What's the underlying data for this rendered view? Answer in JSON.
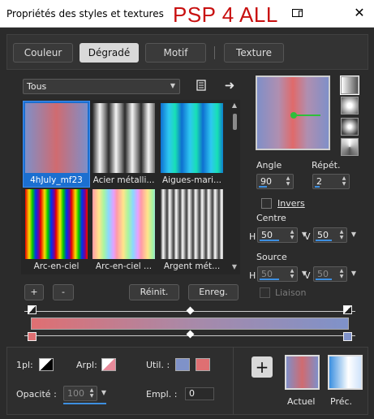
{
  "window": {
    "title": "Propriétés des styles et textures",
    "watermark": "PSP 4 ALL",
    "close_glyph": "✕"
  },
  "tabs": [
    {
      "label": "Couleur",
      "active": false
    },
    {
      "label": "Dégradé",
      "active": true
    },
    {
      "label": "Motif",
      "active": false
    },
    {
      "label": "Texture",
      "active": false
    }
  ],
  "library": {
    "category": "Tous",
    "swatches": [
      {
        "caption": "4hJuly_mf23",
        "selected": true
      },
      {
        "caption": "Acier métalli...",
        "selected": false
      },
      {
        "caption": "Aigues-mari...",
        "selected": false
      },
      {
        "caption": "Arc-en-ciel",
        "selected": false
      },
      {
        "caption": "Arc-en-ciel ...",
        "selected": false
      },
      {
        "caption": "Argent mét...",
        "selected": false
      }
    ]
  },
  "settings": {
    "angle_label": "Angle",
    "angle_value": "90",
    "repeat_label": "Répét.",
    "repeat_value": "2",
    "invert_label": "Invers",
    "center_label": "Centre",
    "center_h": "50",
    "center_v": "50",
    "source_label": "Source",
    "source_h": "50",
    "source_v": "50",
    "h_label": "H",
    "v_label": "V",
    "link_label": "Liaison"
  },
  "buttons": {
    "add": "+",
    "remove": "-",
    "reset": "Réinit.",
    "save": "Enreg."
  },
  "bottom": {
    "fg_label": "1pl:",
    "bg_label": "Arpl:",
    "use_label": "Util. :",
    "opacity_label": "Opacité :",
    "opacity_value": "100",
    "location_label": "Empl. :",
    "location_value": "0",
    "add_glyph": "+",
    "current_label": "Actuel",
    "previous_label": "Préc."
  },
  "colors": {
    "stop_left": "#df6f72",
    "stop_mid": "#a989a8",
    "stop_right": "#7f92c9",
    "accent": "#1b6fd0"
  }
}
